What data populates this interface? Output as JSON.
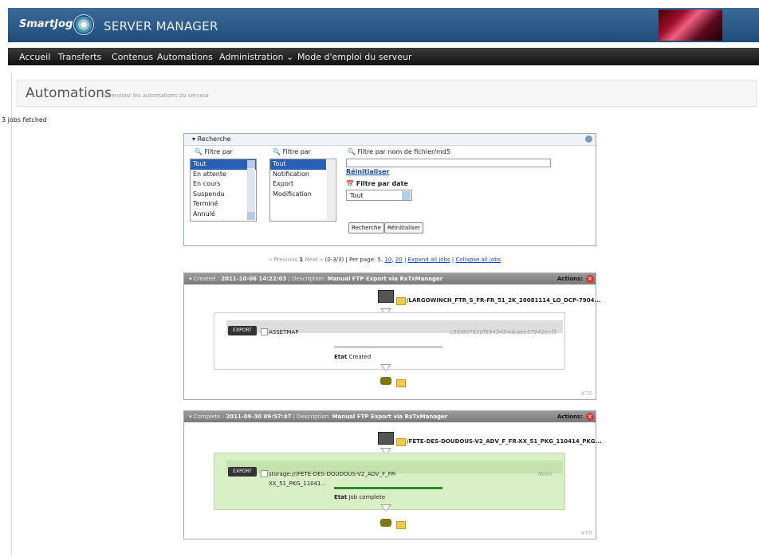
{
  "header": {
    "logo": "SmartJog",
    "title": "SERVER MANAGER"
  },
  "nav": [
    "Accueil",
    "Transferts",
    "Contenus",
    "Automations",
    "Administration ⌄",
    "Mode d'emploi du serveur"
  ],
  "page": {
    "title": "Automations",
    "subtitle": "Supervisez les automations du serveur",
    "fetched": "3 jobs fetched"
  },
  "search": {
    "header": "Recherche",
    "filter1": {
      "label": "Filtre par",
      "options": [
        "Tout",
        "En attente",
        "En cours",
        "Suspendu",
        "Terminé",
        "Annulé"
      ]
    },
    "filter2": {
      "label": "Filtre par",
      "options": [
        "Tout",
        "Notification",
        "Export",
        "Modification"
      ]
    },
    "filename_label": "Filtre par nom de fichier/md5",
    "reset_link": "Réinitialiser",
    "date_label": "Filtre par date",
    "date_value": "Tout",
    "search_btn": "Recherche",
    "reset_btn": "Réinitialiser"
  },
  "pager": {
    "prev": "« Previous",
    "current": "1",
    "next": "Next »",
    "range": "(0-3/3)",
    "perpage": "| Per page: 5,",
    "p10": "10",
    "sep1": ",",
    "p20": "20",
    "sep2": "|",
    "expand": "Expand all jobs",
    "sep3": "|",
    "collapse": "Collapse all jobs"
  },
  "jobs": [
    {
      "status": "Created",
      "date": "2011-10-06 14:22:03",
      "desc_label": "Description:",
      "desc": "Manual FTP Export via RxTxManager",
      "actions": "Actions:",
      "file": "/LARGOWINCH_FTR_S_FR-FR_51_2K_20081114_LO_DCP-7904...",
      "task_name": "ASSETMAP",
      "task_hash": "c3f0607820f5943454dcaee57942ecf3",
      "state_label": "Etat",
      "state": "Created",
      "progress": 0.0,
      "corner": "#70"
    },
    {
      "status": "Complete",
      "date": "2011-09-30 09:57:47",
      "desc_label": "Description:",
      "desc": "Manual FTP Export via RxTxManager",
      "actions": "Actions:",
      "file": "/FETE-DES-DOUDOUS-V2_ADV_F_FR-XX_51_PKG_110414_PKG...",
      "task_line1": "storage:///FETE-DES-DOUDOUS-V2_ADV_F_FR-",
      "task_line2": "XX_51_PKG_11041...",
      "task_hash": "None",
      "state_label": "Etat",
      "state": "Job complete",
      "progress": 1.0,
      "corner": "#69"
    }
  ],
  "icon_names": [
    "logo-icon",
    "banner-image",
    "file-icon",
    "folder-icon",
    "export-icon",
    "ftp-icon",
    "close-icon"
  ],
  "colors": {
    "topbar": "#2b5a89",
    "navbar": "#1e1e1e",
    "complete": "#d9f0c6",
    "progress": "#2a8a2a"
  }
}
